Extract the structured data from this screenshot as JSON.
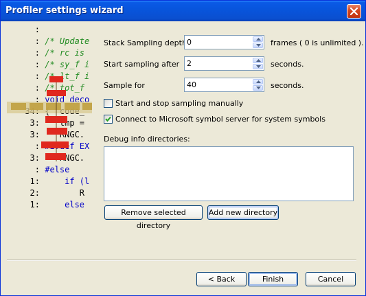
{
  "window": {
    "title": "Profiler settings wizard"
  },
  "code_preview": {
    "lines": [
      {
        "num": ":",
        "code": ""
      },
      {
        "num": ":",
        "code": "/* Update"
      },
      {
        "num": ":",
        "code": "/* rc is"
      },
      {
        "num": ":",
        "code": "/* sy_f i"
      },
      {
        "num": ":",
        "code": "/* lt_f i"
      },
      {
        "num": ":",
        "code": "/* tot_f"
      },
      {
        "num": ":",
        "code": "void deco"
      },
      {
        "num": "34:",
        "code": "{  code_"
      },
      {
        "num": "3:",
        "code": "   tmp ="
      },
      {
        "num": "3:",
        "code": "   RNGC."
      },
      {
        "num": ":",
        "code": "#ifdef EX"
      },
      {
        "num": "3:",
        "code": "   RNGC."
      },
      {
        "num": ":",
        "code": "#else"
      },
      {
        "num": "1:",
        "code": "    if (l"
      },
      {
        "num": "2:",
        "code": "       R"
      },
      {
        "num": "1:",
        "code": "    else"
      }
    ]
  },
  "settings": {
    "stack_depth": {
      "label": "Stack Sampling depth:",
      "value": "0",
      "suffix": "frames ( 0 is unlimited )."
    },
    "start_after": {
      "label": "Start sampling after",
      "value": "2",
      "suffix": "seconds."
    },
    "sample_for": {
      "label": "Sample for",
      "value": "40",
      "suffix": "seconds."
    },
    "manual_sampling": {
      "label": "Start and stop sampling manually",
      "checked": false
    },
    "symbol_server": {
      "label": "Connect to Microsoft symbol server for system symbols",
      "checked": true
    }
  },
  "debug_dirs": {
    "label": "Debug info directories:",
    "items": [],
    "remove_label": "Remove selected directory",
    "add_label": "Add new directory"
  },
  "footer": {
    "back": "< Back",
    "finish": "Finish",
    "cancel": "Cancel"
  },
  "colors": {
    "title_bar": "#0a5ae6",
    "dialog_bg": "#ece9d8",
    "comment": "#228b22",
    "keyword": "#0000c8",
    "graph_node": "#e0281e"
  }
}
